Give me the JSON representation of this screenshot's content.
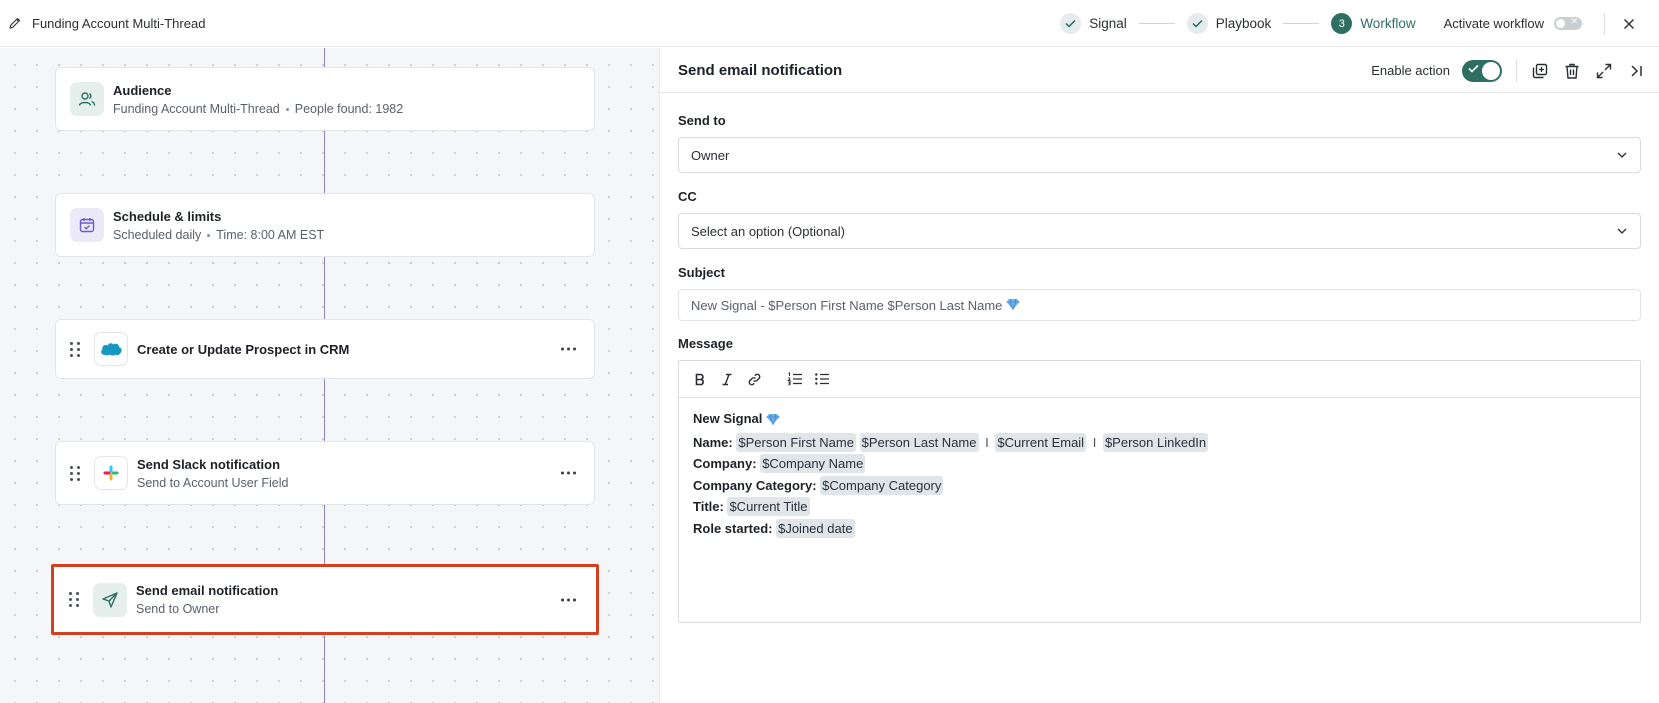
{
  "header": {
    "workflow_title": "Funding Account Multi-Thread",
    "steps": [
      {
        "number": "",
        "label": "Signal",
        "state": "done"
      },
      {
        "number": "",
        "label": "Playbook",
        "state": "done"
      },
      {
        "number": "3",
        "label": "Workflow",
        "state": "active"
      }
    ],
    "activate_label": "Activate workflow",
    "activate_state": "off"
  },
  "canvas": {
    "nodes": [
      {
        "title": "Audience",
        "sub_a": "Funding Account Multi-Thread",
        "sub_b": "People found: 1982",
        "icon": "people-icon"
      },
      {
        "title": "Schedule & limits",
        "sub_a": "Scheduled daily",
        "sub_b": "Time: 8:00 AM EST",
        "icon": "calendar-icon"
      },
      {
        "title": "Create or Update Prospect in CRM",
        "icon": "salesforce-icon"
      },
      {
        "title": "Send Slack notification",
        "sub_a": "Send to Account User Field",
        "icon": "slack-icon"
      },
      {
        "title": "Send email notification",
        "sub_a": "Send to Owner",
        "icon": "paper-plane-icon",
        "selected": true
      }
    ]
  },
  "panel": {
    "title": "Send email notification",
    "enable_label": "Enable action",
    "enable_state": "on",
    "send_to_label": "Send to",
    "send_to_value": "Owner",
    "cc_label": "CC",
    "cc_placeholder": "Select an option (Optional)",
    "subject_label": "Subject",
    "subject_value": "New Signal - $Person First Name $Person Last Name",
    "message_label": "Message",
    "message": {
      "heading": "New Signal",
      "name_label": "Name:",
      "name_tokens": [
        "$Person First Name",
        "$Person Last Name",
        "$Current Email",
        "$Person LinkedIn"
      ],
      "separator": "I",
      "company_label": "Company:",
      "company_token": "$Company Name",
      "category_label": "Company Category:",
      "category_token": "$Company Category",
      "title_label": "Title:",
      "title_token": "$Current Title",
      "role_label": "Role started:",
      "role_token": "$Joined date"
    }
  },
  "colors": {
    "accent": "#2f6f63",
    "highlight": "#d2401f",
    "connector": "#8c86c9",
    "chip": "#e0e5ea"
  }
}
